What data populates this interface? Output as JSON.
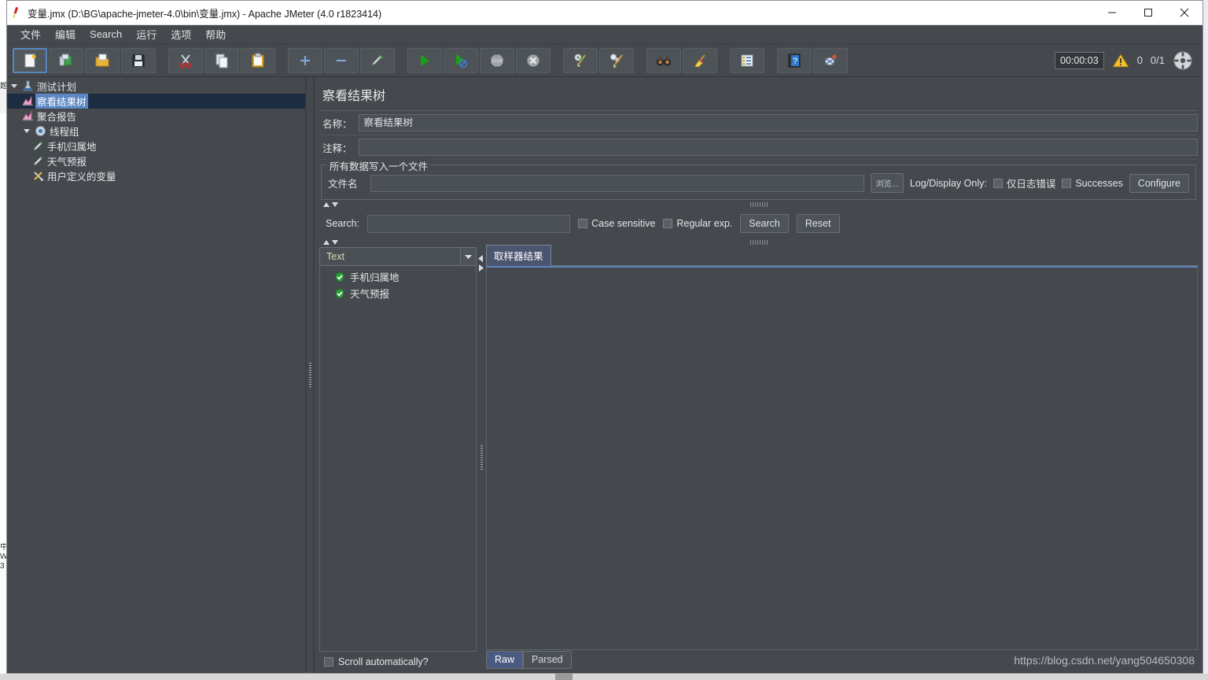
{
  "window": {
    "title": "变量.jmx (D:\\BG\\apache-jmeter-4.0\\bin\\变量.jmx) - Apache JMeter (4.0 r1823414)",
    "app_icon": "jmeter-feather-icon",
    "controls": {
      "minimize": "minimize-icon",
      "maximize": "maximize-icon",
      "close": "close-icon"
    }
  },
  "menu": {
    "items": [
      {
        "label": "文件",
        "name": "menu-file"
      },
      {
        "label": "编辑",
        "name": "menu-edit"
      },
      {
        "label": "Search",
        "name": "menu-search",
        "mnemonic": "S"
      },
      {
        "label": "运行",
        "name": "menu-run"
      },
      {
        "label": "选项",
        "name": "menu-options"
      },
      {
        "label": "帮助",
        "name": "menu-help"
      }
    ]
  },
  "toolbar": {
    "buttons": [
      {
        "name": "new-button",
        "icon": "new-document-icon",
        "selected": true
      },
      {
        "name": "templates-button",
        "icon": "templates-icon",
        "selected": false
      },
      {
        "name": "open-button",
        "icon": "open-folder-icon",
        "selected": false
      },
      {
        "name": "save-button",
        "icon": "floppy-save-icon",
        "selected": false
      },
      {
        "name": "cut-button",
        "icon": "scissors-icon",
        "selected": false
      },
      {
        "name": "copy-button",
        "icon": "copy-icon",
        "selected": false
      },
      {
        "name": "paste-button",
        "icon": "clipboard-paste-icon",
        "selected": false
      },
      {
        "name": "expand-all-button",
        "icon": "plus-icon",
        "selected": false
      },
      {
        "name": "collapse-all-button",
        "icon": "minus-icon",
        "selected": false
      },
      {
        "name": "toggle-button",
        "icon": "toggle-pencil-icon",
        "selected": false
      },
      {
        "name": "start-button",
        "icon": "play-green-icon",
        "selected": false
      },
      {
        "name": "start-no-pauses-button",
        "icon": "play-no-pause-icon",
        "selected": false
      },
      {
        "name": "stop-button",
        "icon": "stop-sign-icon",
        "selected": false
      },
      {
        "name": "shutdown-button",
        "icon": "shutdown-x-icon",
        "selected": false
      },
      {
        "name": "clear-button",
        "icon": "gear-broom-icon",
        "selected": false
      },
      {
        "name": "clear-all-button",
        "icon": "gears-broom-icon",
        "selected": false
      },
      {
        "name": "search-button",
        "icon": "binoculars-icon",
        "selected": false
      },
      {
        "name": "reset-search-button",
        "icon": "broom-icon",
        "selected": false
      },
      {
        "name": "function-helper-button",
        "icon": "list-plus-icon",
        "selected": false
      },
      {
        "name": "help-button",
        "icon": "help-book-icon",
        "selected": false
      },
      {
        "name": "undo-redo-button",
        "icon": "bug-icon",
        "selected": false
      }
    ],
    "timer": "00:00:03",
    "warning_count": "0",
    "thread_count": "0/1",
    "warning_icon": "warning-triangle-icon",
    "activity_icon": "thread-activity-icon"
  },
  "tree": {
    "nodes": [
      {
        "label": "测试计划",
        "icon": "test-plan-icon",
        "indent": 0,
        "toggle": "expanded",
        "selected": false,
        "name": "tree-node-test-plan"
      },
      {
        "label": "察看结果树",
        "icon": "view-results-tree-icon",
        "indent": 1,
        "toggle": "none",
        "selected": true,
        "name": "tree-node-view-results-tree"
      },
      {
        "label": "聚合报告",
        "icon": "aggregate-report-icon",
        "indent": 1,
        "toggle": "none",
        "selected": false,
        "name": "tree-node-aggregate-report"
      },
      {
        "label": "线程组",
        "icon": "thread-group-icon",
        "indent": 0,
        "toggle": "expanded",
        "selected": false,
        "name": "tree-node-thread-group"
      },
      {
        "label": "手机归属地",
        "icon": "http-sampler-icon",
        "indent": 1,
        "toggle": "none",
        "selected": false,
        "name": "tree-node-phone-location"
      },
      {
        "label": "天气预报",
        "icon": "http-sampler-icon",
        "indent": 1,
        "toggle": "none",
        "selected": false,
        "name": "tree-node-weather-forecast"
      },
      {
        "label": "用户定义的变量",
        "icon": "user-defined-variables-icon",
        "indent": 1,
        "toggle": "none",
        "selected": false,
        "name": "tree-node-user-defined-variables"
      }
    ]
  },
  "panel": {
    "title": "察看结果树",
    "name_label": "名称：",
    "name_value": "察看结果树",
    "comment_label": "注释：",
    "comment_value": "",
    "file_group": {
      "title": "所有数据写入一个文件",
      "filename_label": "文件名",
      "filename_value": "",
      "browse_label": "浏览...",
      "log_display_label": "Log/Display Only:",
      "errors_only_label": "仅日志错误",
      "errors_only_checked": false,
      "successes_label": "Successes",
      "successes_checked": false,
      "configure_label": "Configure"
    },
    "search": {
      "label": "Search:",
      "value": "",
      "case_sensitive_label": "Case sensitive",
      "case_sensitive_checked": false,
      "regex_label": "Regular exp.",
      "regex_checked": false,
      "search_button": "Search",
      "reset_button": "Reset"
    },
    "results": {
      "renderer_selected": "Text",
      "renderer_arrow_icon": "chevron-down-icon",
      "items": [
        {
          "label": "手机归属地",
          "icon": "success-shield-icon",
          "status": "success"
        },
        {
          "label": "天气预报",
          "icon": "success-shield-icon",
          "status": "success"
        }
      ],
      "scroll_auto_label": "Scroll automatically?",
      "scroll_auto_checked": false
    },
    "sampler": {
      "tabs": [
        {
          "label": "取样器结果",
          "active": true,
          "name": "tab-sampler-result"
        }
      ],
      "bottom_tabs": [
        {
          "label": "Raw",
          "active": true,
          "name": "tab-raw"
        },
        {
          "label": "Parsed",
          "active": false,
          "name": "tab-parsed"
        }
      ],
      "content": ""
    }
  },
  "watermark": "https://blog.csdn.net/yang504650308",
  "colors": {
    "window_bg": "#45494d",
    "titlebar_bg": "#ffffff",
    "accent_blue": "#5c87c4",
    "selected_row": "#1c2d42",
    "text": "#e3e6e9"
  }
}
